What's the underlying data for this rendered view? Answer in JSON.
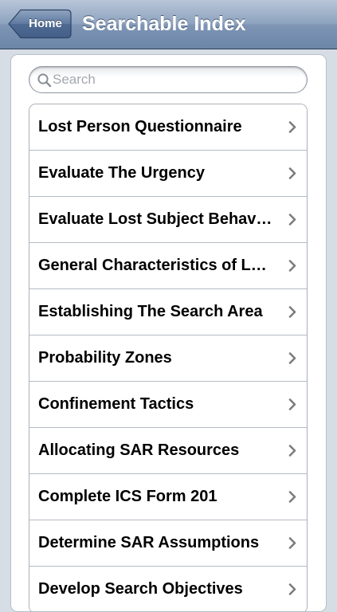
{
  "navbar": {
    "back_label": "Home",
    "title": "Searchable Index"
  },
  "search": {
    "placeholder": "Search",
    "value": ""
  },
  "index": {
    "items": [
      {
        "label": "Lost Person Questionnaire",
        "icon": "chevron-right-icon"
      },
      {
        "label": "Evaluate The Urgency",
        "icon": "chevron-right-icon"
      },
      {
        "label": "Evaluate Lost Subject Behavior",
        "icon": "chevron-right-icon"
      },
      {
        "label": "General Characteristics of Lost Persons",
        "icon": "chevron-right-icon"
      },
      {
        "label": "Establishing The Search Area",
        "icon": "chevron-right-icon"
      },
      {
        "label": "Probability Zones",
        "icon": "chevron-right-icon"
      },
      {
        "label": "Confinement Tactics",
        "icon": "chevron-right-icon"
      },
      {
        "label": "Allocating SAR Resources",
        "icon": "chevron-right-icon"
      },
      {
        "label": "Complete ICS Form 201",
        "icon": "chevron-right-icon"
      },
      {
        "label": "Determine SAR Assumptions",
        "icon": "chevron-right-icon"
      },
      {
        "label": "Develop Search Objectives",
        "icon": "chevron-right-icon"
      }
    ]
  },
  "colors": {
    "navbar_top": "#b8c6d8",
    "navbar_bottom": "#6c86a9",
    "background": "#d7dde5",
    "chevron": "#7d7d7d"
  }
}
